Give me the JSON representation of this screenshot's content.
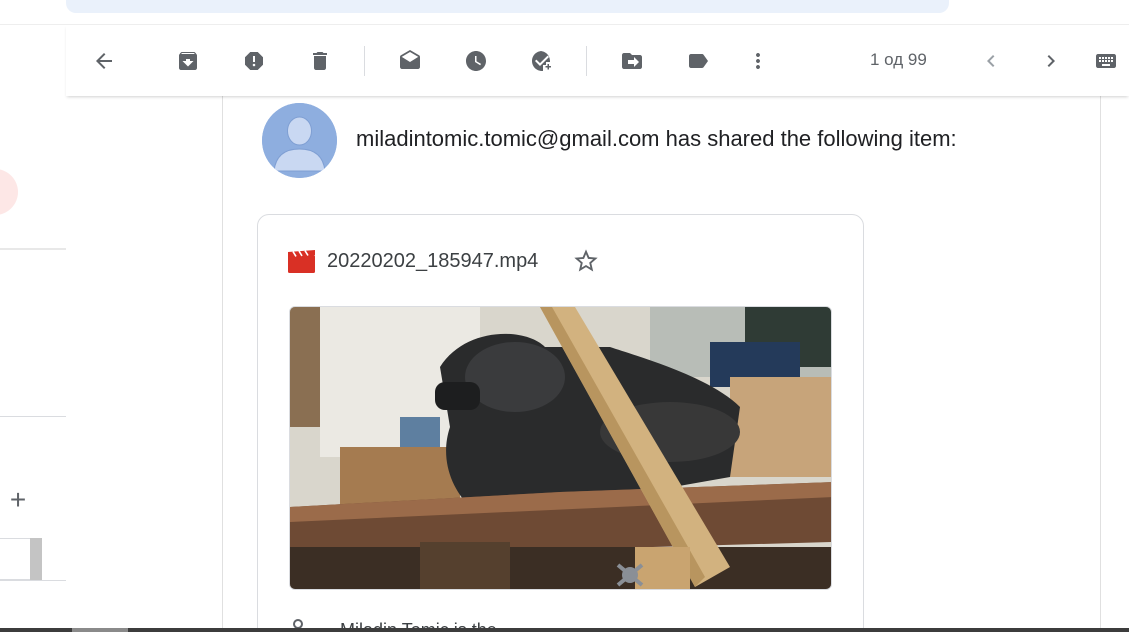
{
  "toolbar": {
    "back": "back-arrow-icon",
    "archive": "archive-icon",
    "spam": "report-spam-icon",
    "delete": "delete-icon",
    "mark_unread": "mark-unread-icon",
    "snooze": "snooze-icon",
    "add_task": "add-task-icon",
    "move_to": "move-to-icon",
    "labels": "label-icon",
    "more": "more-vert-icon",
    "pager": "1 од 99",
    "prev": "chevron-left-icon",
    "next": "chevron-right-icon",
    "keyboard": "keyboard-icon"
  },
  "message": {
    "shared_line": "miladintomic.tomic@gmail.com has shared the following item:",
    "file_name": "20220202_185947.mp4",
    "owner_text": "Miladin Tomic is the"
  },
  "colors": {
    "file_icon_red": "#d93025",
    "avatar_blue": "#8eaedf",
    "compose_pink": "#fde7e6"
  }
}
